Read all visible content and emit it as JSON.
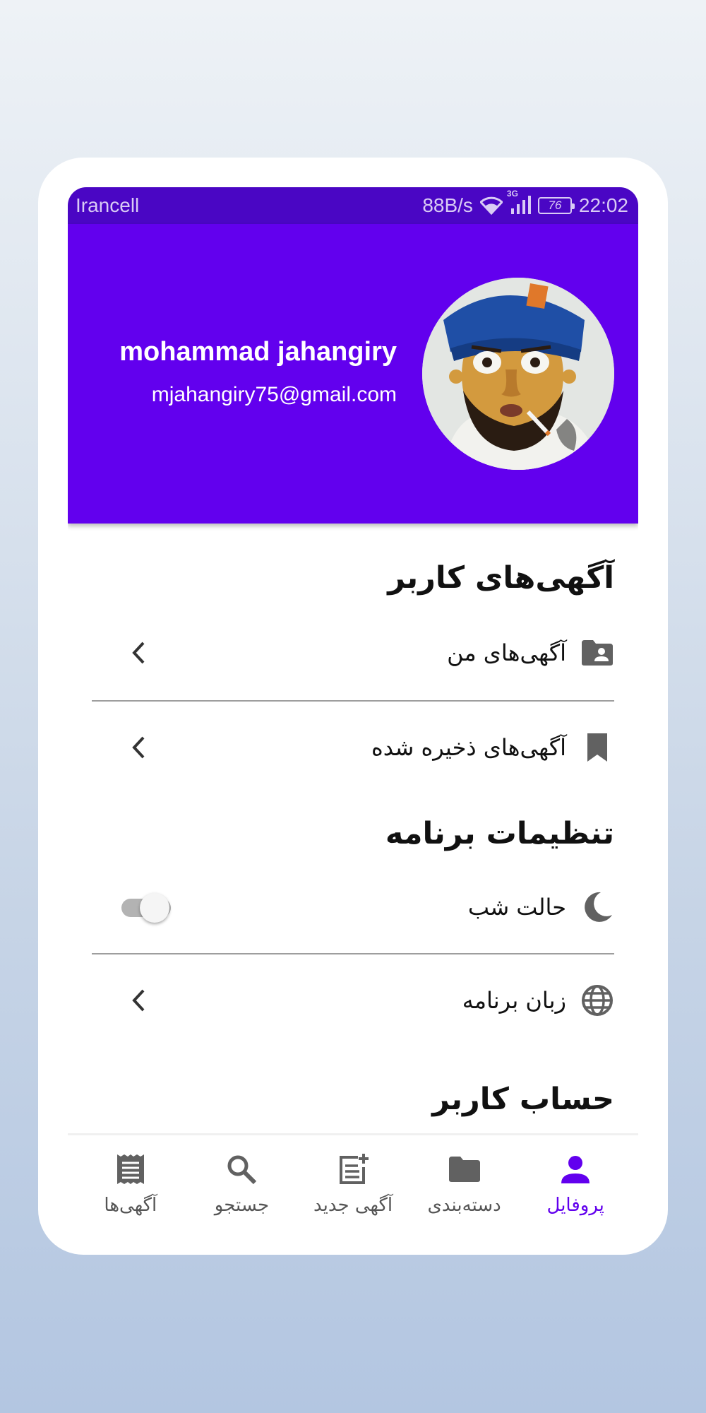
{
  "status_bar": {
    "carrier": "Irancell",
    "speed": "88B/s",
    "network": "3G",
    "battery": "76",
    "time": "22:02",
    "icons": [
      "wifi-icon",
      "signal-icon",
      "battery-icon"
    ]
  },
  "profile": {
    "name": "mohammad jahangiry",
    "email": "mjahangiry75@gmail.com",
    "avatar": "avatar-image"
  },
  "sections": {
    "user_ads": {
      "title": "آگهی‌های کاربر",
      "items": [
        {
          "label": "آگهی‌های من",
          "icon": "folder-user-icon"
        },
        {
          "label": "آگهی‌های ذخیره شده",
          "icon": "bookmark-icon"
        }
      ]
    },
    "app_settings": {
      "title": "تنظیمات برنامه",
      "items": [
        {
          "label": "حالت شب",
          "icon": "moon-icon",
          "toggle": false
        },
        {
          "label": "زبان برنامه",
          "icon": "globe-icon"
        }
      ]
    },
    "account": {
      "title": "حساب کاربر"
    }
  },
  "bottom_nav": [
    {
      "label": "پروفایل",
      "icon": "person-icon",
      "active": true
    },
    {
      "label": "دسته‌بندی",
      "icon": "folder-icon",
      "active": false
    },
    {
      "label": "آگهی جدید",
      "icon": "post-add-icon",
      "active": false
    },
    {
      "label": "جستجو",
      "icon": "search-icon",
      "active": false
    },
    {
      "label": "آگهی‌ها",
      "icon": "list-icon",
      "active": false
    }
  ],
  "colors": {
    "primary": "#6200ee",
    "status_bar": "#4a06c4",
    "icon_gray": "#616161"
  }
}
